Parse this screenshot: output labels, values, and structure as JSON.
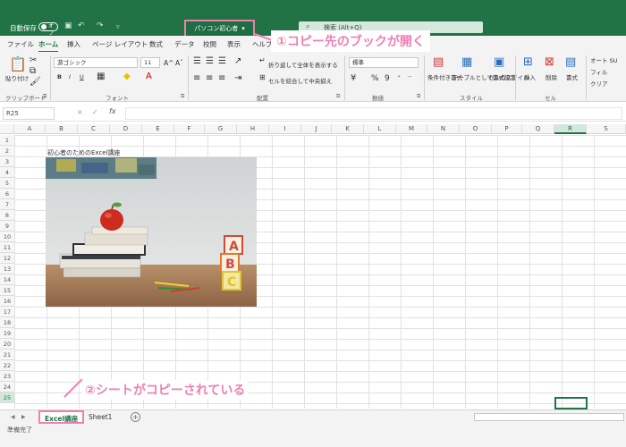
{
  "titlebar": {
    "autosave_label": "自動保存",
    "autosave_state": "オフ",
    "document_title": "パソコン初心者",
    "document_dropdown": "▾",
    "search_placeholder": "検索 (Alt+Q)"
  },
  "tabs": [
    "ファイル",
    "ホーム",
    "挿入",
    "ページ レイアウト",
    "数式",
    "データ",
    "校閲",
    "表示",
    "ヘルプ"
  ],
  "annotation1": "①コピー先のブックが開く",
  "annotation2": "②シートがコピーされている",
  "ribbon": {
    "clipboard": {
      "paste_label": "貼り付け",
      "group_label": "クリップボード"
    },
    "font": {
      "font_name": "游ゴシック",
      "font_size": "11",
      "grow": "A^",
      "shrink": "Aˇ",
      "bold": "B",
      "italic": "I",
      "underline": "U",
      "group_label": "フォント"
    },
    "alignment": {
      "wrap_label": "折り返して全体を表示する",
      "merge_label": "セルを結合して中央揃え",
      "group_label": "配置"
    },
    "number": {
      "format_value": "標準",
      "percent": "%",
      "comma": "9",
      "group_label": "数値"
    },
    "styles": {
      "conditional_label": "条件付き書式",
      "table_label": "テーブルとして書式設定",
      "cell_style_label": "セルのスタイル",
      "group_label": "スタイル"
    },
    "cells": {
      "insert_label": "挿入",
      "delete_label": "削除",
      "format_label": "書式",
      "group_label": "セル"
    },
    "editing": {
      "autosum_label": "オート SU",
      "fill_label": "フィル",
      "clear_label": "クリア"
    }
  },
  "formula_bar": {
    "name_box": "R25",
    "fx": "fx",
    "cancel": "×",
    "enter": "✓"
  },
  "columns": [
    "A",
    "B",
    "C",
    "D",
    "E",
    "F",
    "G",
    "H",
    "I",
    "J",
    "K",
    "L",
    "M",
    "N",
    "O",
    "P",
    "Q",
    "R",
    "S"
  ],
  "rows": [
    "1",
    "2",
    "3",
    "4",
    "5",
    "6",
    "7",
    "8",
    "9",
    "10",
    "11",
    "12",
    "13",
    "14",
    "15",
    "16",
    "17",
    "18",
    "19",
    "20",
    "21",
    "22",
    "23",
    "24",
    "25"
  ],
  "cell_b2": "初心者のためのExcel講座",
  "sheet_tabs": {
    "active": "Excel講座",
    "other": "Sheet1",
    "add": "+"
  },
  "status_text": "準備完了",
  "colors": {
    "brand_green": "#217346",
    "annotation_pink": "#f07fb1"
  }
}
